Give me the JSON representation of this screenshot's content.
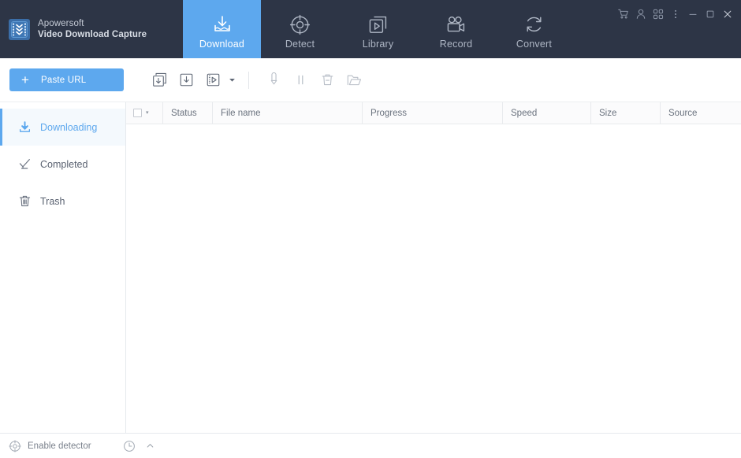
{
  "app": {
    "brand_name": "Apowersoft",
    "brand_product": "Video Download Capture",
    "logo_icon": "film-strip-chevrons-icon"
  },
  "nav": {
    "tabs": [
      {
        "label": "Download",
        "icon": "download-tray-icon",
        "active": true
      },
      {
        "label": "Detect",
        "icon": "detect-target-icon",
        "active": false
      },
      {
        "label": "Library",
        "icon": "library-play-icon",
        "active": false
      },
      {
        "label": "Record",
        "icon": "movie-camera-icon",
        "active": false
      },
      {
        "label": "Convert",
        "icon": "convert-refresh-icon",
        "active": false
      }
    ]
  },
  "window_controls": [
    {
      "name": "cart-icon",
      "title": "Store"
    },
    {
      "name": "user-icon",
      "title": "Account"
    },
    {
      "name": "apps-grid-icon",
      "title": "Apps"
    },
    {
      "name": "more-menu-icon",
      "title": "Menu"
    },
    {
      "name": "minimize-icon",
      "title": "Minimize"
    },
    {
      "name": "maximize-icon",
      "title": "Maximize"
    },
    {
      "name": "close-icon",
      "title": "Close"
    }
  ],
  "toolbar": {
    "paste_url_label": "Paste URL",
    "add_symbol": "+",
    "buttons": [
      {
        "name": "batch-download-button",
        "icon": "batch-download-icon"
      },
      {
        "name": "new-download-button",
        "icon": "download-box-icon"
      },
      {
        "name": "video-download-button",
        "icon": "video-file-icon",
        "has_caret": true
      }
    ],
    "actions": [
      {
        "name": "start-button",
        "icon": "start-arrow-icon"
      },
      {
        "name": "pause-button",
        "icon": "pause-bars-icon"
      },
      {
        "name": "delete-button",
        "icon": "trash-icon"
      },
      {
        "name": "open-folder-button",
        "icon": "open-folder-icon"
      }
    ]
  },
  "sidebar": {
    "items": [
      {
        "label": "Downloading",
        "icon": "download-arrow-icon",
        "active": true
      },
      {
        "label": "Completed",
        "icon": "check-mark-icon",
        "active": false
      },
      {
        "label": "Trash",
        "icon": "trash-bin-icon",
        "active": false
      }
    ]
  },
  "table": {
    "select_all": {
      "checked": false,
      "caret": "▾"
    },
    "columns": [
      {
        "key": "status",
        "label": "Status"
      },
      {
        "key": "filename",
        "label": "File name"
      },
      {
        "key": "progress",
        "label": "Progress"
      },
      {
        "key": "speed",
        "label": "Speed"
      },
      {
        "key": "size",
        "label": "Size"
      },
      {
        "key": "source",
        "label": "Source"
      }
    ],
    "rows": []
  },
  "statusbar": {
    "detector_label": "Enable detector",
    "detector_icon": "detector-target-icon",
    "schedule_icon": "clock-icon",
    "expand_icon": "chevron-up-icon",
    "expand_glyph": "⌃"
  },
  "colors": {
    "header_bg": "#2d3546",
    "accent_blue": "#5da8ee",
    "active_side_bg": "#f4f9fd",
    "table_header_bg": "#fbfbfc",
    "border": "#e6e9ed"
  }
}
